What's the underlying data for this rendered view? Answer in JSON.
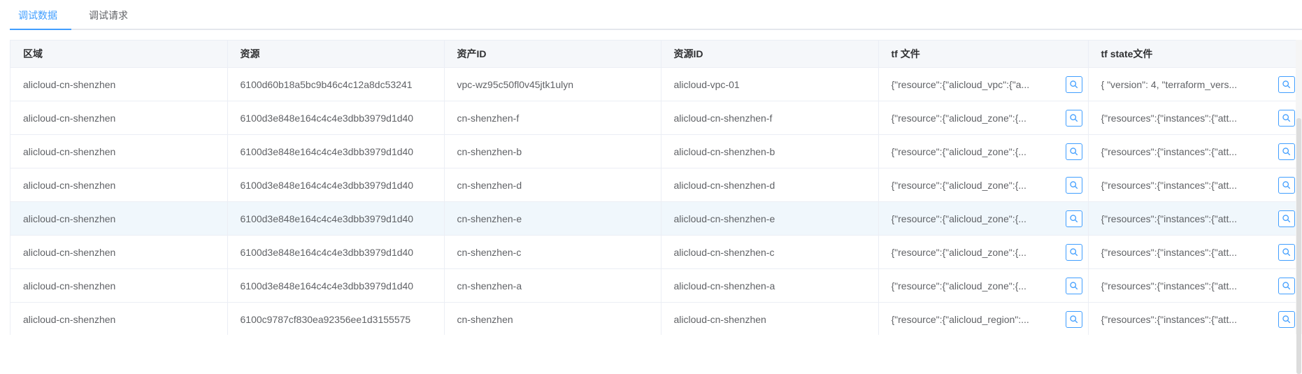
{
  "tabs": [
    {
      "label": "调试数据",
      "active": true
    },
    {
      "label": "调试请求",
      "active": false
    }
  ],
  "table": {
    "columns": [
      "区域",
      "资源",
      "资产ID",
      "资源ID",
      "tf 文件",
      "tf state文件"
    ],
    "rows": [
      [
        "alicloud-cn-shenzhen",
        "6100d60b18a5bc9b46c4c12a8dc53241",
        "vpc-wz95c50fl0v45jtk1ulyn",
        "alicloud-vpc-01",
        "{\"resource\":{\"alicloud_vpc\":{\"a...",
        "{ \"version\": 4, \"terraform_vers..."
      ],
      [
        "alicloud-cn-shenzhen",
        "6100d3e848e164c4c4e3dbb3979d1d40",
        "cn-shenzhen-f",
        "alicloud-cn-shenzhen-f",
        "{\"resource\":{\"alicloud_zone\":{...",
        "{\"resources\":{\"instances\":{\"att..."
      ],
      [
        "alicloud-cn-shenzhen",
        "6100d3e848e164c4c4e3dbb3979d1d40",
        "cn-shenzhen-b",
        "alicloud-cn-shenzhen-b",
        "{\"resource\":{\"alicloud_zone\":{...",
        "{\"resources\":{\"instances\":{\"att..."
      ],
      [
        "alicloud-cn-shenzhen",
        "6100d3e848e164c4c4e3dbb3979d1d40",
        "cn-shenzhen-d",
        "alicloud-cn-shenzhen-d",
        "{\"resource\":{\"alicloud_zone\":{...",
        "{\"resources\":{\"instances\":{\"att..."
      ],
      [
        "alicloud-cn-shenzhen",
        "6100d3e848e164c4c4e3dbb3979d1d40",
        "cn-shenzhen-e",
        "alicloud-cn-shenzhen-e",
        "{\"resource\":{\"alicloud_zone\":{...",
        "{\"resources\":{\"instances\":{\"att..."
      ],
      [
        "alicloud-cn-shenzhen",
        "6100d3e848e164c4c4e3dbb3979d1d40",
        "cn-shenzhen-c",
        "alicloud-cn-shenzhen-c",
        "{\"resource\":{\"alicloud_zone\":{...",
        "{\"resources\":{\"instances\":{\"att..."
      ],
      [
        "alicloud-cn-shenzhen",
        "6100d3e848e164c4c4e3dbb3979d1d40",
        "cn-shenzhen-a",
        "alicloud-cn-shenzhen-a",
        "{\"resource\":{\"alicloud_zone\":{...",
        "{\"resources\":{\"instances\":{\"att..."
      ],
      [
        "alicloud-cn-shenzhen",
        "6100c9787cf830ea92356ee1d3155575",
        "cn-shenzhen",
        "alicloud-cn-shenzhen",
        "{\"resource\":{\"alicloud_region\":...",
        "{\"resources\":{\"instances\":{\"att..."
      ]
    ],
    "hover_row_index": 4,
    "action_icon": "search-icon"
  },
  "colors": {
    "accent": "#409eff",
    "header_bg": "#f5f7fa",
    "hover_bg": "#f0f7fc",
    "border": "#ebeef5",
    "text": "#606266"
  }
}
